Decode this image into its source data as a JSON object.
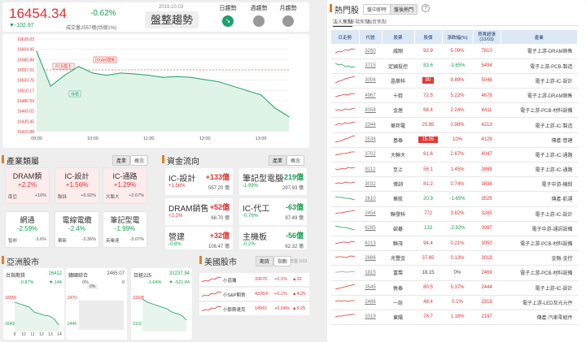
{
  "index": {
    "value": "16454.34",
    "pct": "-0.62%",
    "change": "▼-102.97",
    "volume_label": "成交量2557億(估德1%)",
    "date": "2019.10.03",
    "trend": "盤整趨勢"
  },
  "trend_tabs": [
    {
      "label": "日趨勢"
    },
    {
      "label": "週趨勢"
    },
    {
      "label": "月趨勢"
    }
  ],
  "main_chart": {
    "y_ticks": [
      "16628.03",
      "16604.45",
      "16580.88",
      "16557.31",
      "16533.76",
      "16510.17",
      "16486.59",
      "16463.02",
      "16439.45",
      "16415.88"
    ],
    "x_ticks": [
      "09:00",
      "10:00",
      "11:00",
      "12:00",
      "13:00"
    ],
    "annotations": {
      "pcb": "PCB趨半",
      "dram": "DRAM趨勢",
      "green": "綠箱"
    }
  },
  "chart_data": {
    "type": "line",
    "title": "",
    "xlabel": "",
    "ylabel": "",
    "ylim": [
      16415.88,
      16628.03
    ],
    "x": [
      "09:00",
      "09:15",
      "09:30",
      "09:45",
      "10:00",
      "10:15",
      "10:30",
      "10:45",
      "11:00",
      "11:15",
      "11:30",
      "11:45",
      "12:00",
      "12:15",
      "12:30",
      "12:45",
      "13:00",
      "13:15",
      "13:30"
    ],
    "series": [
      {
        "values": [
          16600,
          16520,
          16545,
          16565,
          16550,
          16545,
          16550,
          16548,
          16545,
          16540,
          16542,
          16540,
          16535,
          16530,
          16520,
          16510,
          16500,
          16470,
          16450
        ]
      }
    ]
  },
  "industry": {
    "title": "產業類屬",
    "tabs": [
      "產業",
      "概念"
    ],
    "cards": [
      {
        "name": "DRAM類",
        "pct": "+2.2%",
        "l1": "南亞",
        "l1v": "+10%",
        "l2": "",
        "l2v": "",
        "up": true
      },
      {
        "name": "IC-設計",
        "pct": "+1.56%",
        "l1": "聯詠",
        "l1v": "+9.92%",
        "l2": "",
        "l2v": "",
        "up": true
      },
      {
        "name": "IC-通路",
        "pct": "+1.29%",
        "l1": "大聯大",
        "l1v": "+2.67%",
        "l2": "",
        "l2v": "",
        "up": true
      },
      {
        "name": "網通",
        "pct": "-2.59%",
        "l1": "智邦",
        "l1v": "-3.6%",
        "l2": "",
        "l2v": "",
        "up": false
      },
      {
        "name": "電線電纜",
        "pct": "-2.4%",
        "l1": "華新",
        "l1v": "-3.36%",
        "l2": "",
        "l2v": "",
        "up": false
      },
      {
        "name": "筆記型電",
        "pct": "-1.99%",
        "l1": "英業達",
        "l1v": "-3.07%",
        "l2": "",
        "l2v": "",
        "up": false
      }
    ]
  },
  "fund_flow": {
    "title": "資金流向",
    "tabs": [
      "產業",
      "概念"
    ],
    "cards": [
      {
        "name": "IC-設計",
        "value": "+133億",
        "change": "+1.56%",
        "total": "557.20 億",
        "up": true
      },
      {
        "name": "筆記型電腦",
        "value": "-219億",
        "change": "-1.99%",
        "total": "297.93 億",
        "up": false
      },
      {
        "name": "DRAM銷售",
        "value": "+52億",
        "change": "+2.2%",
        "total": "68.70 億",
        "up": true
      },
      {
        "name": "IC-代工",
        "value": "-63億",
        "change": "-0.76%",
        "total": "97.49 億",
        "up": false
      },
      {
        "name": "營建",
        "value": "+32億",
        "change": "-0.8%",
        "total": "106.47 億",
        "up": true
      },
      {
        "name": "主機板",
        "value": "-56億",
        "change": "-0.2%",
        "total": "62.32 億",
        "up": false
      }
    ]
  },
  "asia": {
    "title": "亞洲股市",
    "charts": [
      {
        "name": "台指期貨",
        "value": "16412",
        "chg": "-0.87%",
        "chg2": "▼ 144",
        "tick_top": "16559",
        "tick_bot": "16408",
        "x": [
          "9",
          "10",
          "11",
          "12",
          "13",
          "14"
        ]
      },
      {
        "name": "韓國綜合",
        "value": "2465.07",
        "chg": "0%",
        "chg2": "0",
        "tick_top": "2470",
        "tick_bot": "2446",
        "x": []
      },
      {
        "name": "日經225",
        "value": "31237.94",
        "chg": "-1.64%",
        "chg2": "▼ -521.84",
        "tick_top": "31608",
        "tick_bot": "31157",
        "x": []
      }
    ]
  },
  "us": {
    "title": "美國股市",
    "tabs": [
      "期貨",
      "指數"
    ],
    "time": "日盤 10/3",
    "rows": [
      {
        "name": "小道瓊",
        "value": "33670",
        "pct": "+0.1%",
        "chg": "▲32"
      },
      {
        "name": "小S&P期貨",
        "value": "4328.5",
        "pct": "+0.1%",
        "chg": "▲4.25"
      },
      {
        "name": "小那斯達克",
        "value": "14991",
        "pct": "+0.04%",
        "chg": "▲6.25"
      }
    ]
  },
  "hot": {
    "title": "熱門股",
    "top_tabs": [
      "盤中即時",
      "盤後熱門"
    ],
    "sub_tabs": [
      "法人焦點",
      "市場焦點",
      "融資焦點"
    ],
    "headers": [
      "日走勢",
      "代號",
      "股票",
      "股價",
      "漲跌幅(%)",
      "買賣超張\n(10/03)",
      "產業"
    ],
    "rows": [
      {
        "code": "3260",
        "name": "威剛",
        "price": "92.9",
        "pct": "5.09%",
        "vol": "7810",
        "ind": "電子上游-DRAM銷售",
        "up": true,
        "hl": false
      },
      {
        "code": "3715",
        "name": "定穎投控",
        "price": "83.6",
        "pct": "-1.65%",
        "vol": "5494",
        "ind": "電子上游-PCB-製造",
        "up": false,
        "hl": false
      },
      {
        "code": "3006",
        "name": "晶豪科",
        "price": "90",
        "pct": "9.89%",
        "vol": "5046",
        "ind": "電子上游-IC-設計",
        "up": true,
        "hl": true
      },
      {
        "code": "4967",
        "name": "十銓",
        "price": "72.5",
        "pct": "5.22%",
        "vol": "4678",
        "ind": "電子上游-DRAM銷售",
        "up": true,
        "hl": false
      },
      {
        "code": "8358",
        "name": "金居",
        "price": "68.4",
        "pct": "2.24%",
        "vol": "4411",
        "ind": "電子上游-PCB-材料設備",
        "up": true,
        "hl": false
      },
      {
        "code": "2344",
        "name": "華邦電",
        "price": "25.85",
        "pct": "0.98%",
        "vol": "4213",
        "ind": "電子上游-IC-製造",
        "up": true,
        "hl": false
      },
      {
        "code": "2538",
        "name": "基泰",
        "price": "15.95",
        "pct": "10%",
        "vol": "4129",
        "ind": "傳產-營建",
        "up": true,
        "hl": true
      },
      {
        "code": "3702",
        "name": "大聯大",
        "price": "61.6",
        "pct": "2.67%",
        "vol": "4047",
        "ind": "電子上游-IC-通路",
        "up": true,
        "hl": false
      },
      {
        "code": "8112",
        "name": "至上",
        "price": "56.1",
        "pct": "1.45%",
        "vol": "3888",
        "ind": "電子上游-IC-通路",
        "up": true,
        "hl": false
      },
      {
        "code": "3032",
        "name": "偉訓",
        "price": "81.2",
        "pct": "0.74%",
        "vol": "3836",
        "ind": "電子中游-機殼",
        "up": true,
        "hl": false
      },
      {
        "code": "2610",
        "name": "華航",
        "price": "20.9",
        "pct": "-1.65%",
        "vol": "3525",
        "ind": "傳產-航運",
        "up": false,
        "hl": false
      },
      {
        "code": "2454",
        "name": "聯發科",
        "price": "772",
        "pct": "3.62%",
        "vol": "3285",
        "ind": "電子上游-IC-設計",
        "up": true,
        "hl": false
      },
      {
        "code": "6285",
        "name": "啟碁",
        "price": "133",
        "pct": "-2.92%",
        "vol": "3087",
        "ind": "電子中游-通訊設備",
        "up": false,
        "hl": false
      },
      {
        "code": "6213",
        "name": "聯茂",
        "price": "94.4",
        "pct": "0.21%",
        "vol": "3050",
        "ind": "電子上游-PCB-材料設備",
        "up": true,
        "hl": false
      },
      {
        "code": "2886",
        "name": "兆豐金",
        "price": "37.65",
        "pct": "0.13%",
        "vol": "3019",
        "ind": "金融-金控",
        "up": true,
        "hl": false
      },
      {
        "code": "1815",
        "name": "富喬",
        "price": "18.15",
        "pct": "0%",
        "vol": "2469",
        "ind": "電子上游-PCB-材料設備",
        "up": null,
        "hl": false
      },
      {
        "code": "3545",
        "name": "敦泰",
        "price": "80.5",
        "pct": "5.37%",
        "vol": "2444",
        "ind": "電子上游-IC-設計",
        "up": true,
        "hl": false
      },
      {
        "code": "2486",
        "name": "一詮",
        "price": "48.4",
        "pct": "0.1%",
        "vol": "2316",
        "ind": "電子上游-LED及光元件",
        "up": true,
        "hl": false
      },
      {
        "code": "3319",
        "name": "東陽",
        "price": "78.7",
        "pct": "1.16%",
        "vol": "2197",
        "ind": "傳產-汽車零組件",
        "up": true,
        "hl": false
      }
    ]
  },
  "colors": {
    "up": "#e03030",
    "down": "#18a050",
    "accent": "#e67e22"
  }
}
